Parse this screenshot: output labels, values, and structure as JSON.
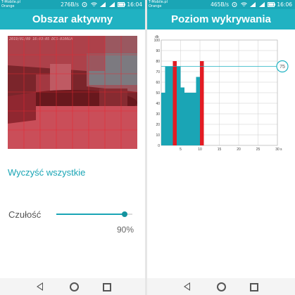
{
  "left_screen": {
    "status": {
      "carrier1": "T-Mobile.pl",
      "carrier2": "Orange",
      "speed": "276B/s",
      "battery": "95",
      "time": "16:04"
    },
    "title": "Obszar aktywny",
    "camera_timestamp": "2019/01/09 16:03:05 DCS-8100LH",
    "clear_all_label": "Wyczyść wszystkie",
    "sensitivity_label": "Czułość",
    "sensitivity_value": "90%",
    "sensitivity_level": 0.9
  },
  "right_screen": {
    "status": {
      "carrier1": "T-Mobile.pl",
      "carrier2": "Orange",
      "speed": "465B/s",
      "battery": "95",
      "time": "16:06"
    },
    "title": "Poziom wykrywania",
    "threshold_badge": "75"
  },
  "colors": {
    "accent": "#20b2c2",
    "status": "#1aa5b5",
    "bar": "#1aa5b5",
    "bar_alert": "#e31b23"
  },
  "chart_data": {
    "type": "bar",
    "ylabel": "db",
    "xlabel": "s",
    "ylim": [
      0,
      100
    ],
    "xlim": [
      0,
      30
    ],
    "yticks": [
      0,
      10,
      20,
      30,
      40,
      50,
      60,
      70,
      80,
      90,
      100
    ],
    "xticks": [
      5,
      10,
      15,
      20,
      25,
      30
    ],
    "threshold": 75,
    "bars": [
      {
        "x": 0,
        "value": 50,
        "alert": false
      },
      {
        "x": 1,
        "value": 75,
        "alert": false
      },
      {
        "x": 2,
        "value": 75,
        "alert": false
      },
      {
        "x": 3,
        "value": 80,
        "alert": true
      },
      {
        "x": 4,
        "value": 75,
        "alert": false
      },
      {
        "x": 5,
        "value": 55,
        "alert": false
      },
      {
        "x": 6,
        "value": 50,
        "alert": false
      },
      {
        "x": 7,
        "value": 50,
        "alert": false
      },
      {
        "x": 8,
        "value": 50,
        "alert": false
      },
      {
        "x": 9,
        "value": 65,
        "alert": false
      },
      {
        "x": 10,
        "value": 80,
        "alert": true
      }
    ]
  }
}
